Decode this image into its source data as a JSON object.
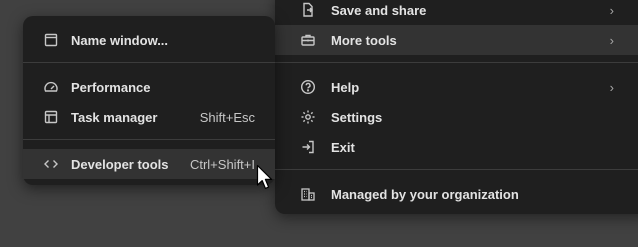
{
  "main_menu": {
    "items": [
      {
        "label": "Save and share",
        "icon": "save-share-icon",
        "has_submenu": true
      },
      {
        "label": "More tools",
        "icon": "toolbox-icon",
        "has_submenu": true,
        "highlighted": true
      },
      {
        "label": "Help",
        "icon": "help-icon",
        "has_submenu": true
      },
      {
        "label": "Settings",
        "icon": "gear-icon",
        "has_submenu": false
      },
      {
        "label": "Exit",
        "icon": "exit-icon",
        "has_submenu": false
      },
      {
        "label": "Managed by your organization",
        "icon": "building-icon",
        "has_submenu": false
      }
    ]
  },
  "sub_menu": {
    "items": [
      {
        "label": "Name window...",
        "icon": "window-icon",
        "shortcut": ""
      },
      {
        "label": "Performance",
        "icon": "speedometer-icon",
        "shortcut": ""
      },
      {
        "label": "Task manager",
        "icon": "task-manager-icon",
        "shortcut": "Shift+Esc"
      },
      {
        "label": "Developer tools",
        "icon": "code-icon",
        "shortcut": "Ctrl+Shift+I",
        "highlighted": true
      }
    ]
  },
  "colors": {
    "backdrop": "#414141",
    "menu_bg": "#1f1f1f",
    "highlight": "#333333",
    "text": "#e3e3e3"
  }
}
